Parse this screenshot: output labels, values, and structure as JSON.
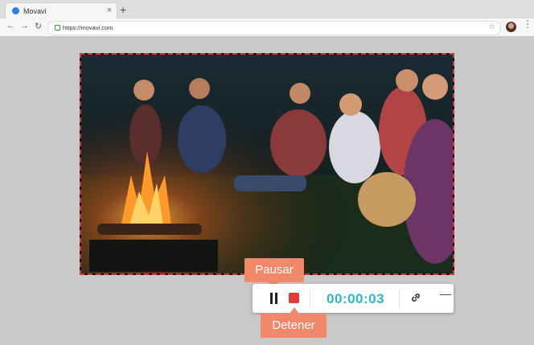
{
  "browser": {
    "tab_title": "Movavi",
    "tab_close": "×",
    "new_tab": "+",
    "url": "https://movavi.com",
    "nav": {
      "back": "←",
      "forward": "→",
      "reload": "↻"
    },
    "star": "☆",
    "menu": "⋮"
  },
  "recorder": {
    "timer": "00:00:03",
    "minimize": "—",
    "pause_callout": "Pausar",
    "stop_callout": "Detener"
  },
  "colors": {
    "frame_border": "#d0363e",
    "stop_red": "#e23b3b",
    "timer_teal": "#29b6c8",
    "callout_orange": "#f2886a"
  },
  "icons": [
    "favicon-icon",
    "back-icon",
    "forward-icon",
    "reload-icon",
    "lock-icon",
    "star-icon",
    "avatar",
    "menu-icon",
    "pause-icon",
    "stop-icon",
    "link-icon",
    "minimize-icon"
  ]
}
